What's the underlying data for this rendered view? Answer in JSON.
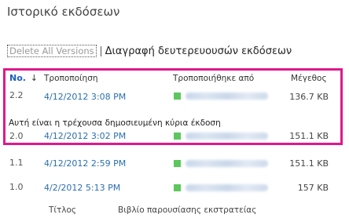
{
  "page": {
    "title": "Ιστορικό εκδόσεων"
  },
  "toolbar": {
    "delete_all_label": "Delete All Versions",
    "delete_minor_label": "Διαγραφή δευτερευουσών εκδόσεων"
  },
  "table": {
    "headers": {
      "no": "No.",
      "sort_arrow": "↓",
      "modified": "Τροποποίηση",
      "modified_by": "Τροποποιήθηκε από",
      "size": "Μέγεθος"
    },
    "current_note": "Αυτή είναι η τρέχουσα δημοσιευμένη κύρια έκδοση",
    "rows": [
      {
        "version": "2.2",
        "modified": "4/12/2012 3:08 PM",
        "size": "136.7 KB"
      },
      {
        "version": "2.0",
        "modified": "4/12/2012 3:02 PM",
        "size": "151.1 KB"
      },
      {
        "version": "1.1",
        "modified": "4/12/2012 2:59 PM",
        "size": "151.1 KB"
      },
      {
        "version": "1.0",
        "modified": "4/2/2012 5:13 PM",
        "size": "157 KB"
      }
    ]
  },
  "footer": {
    "title_label": "Τίτλος",
    "viewer_label": "Βιβλίο παρουσίασης εκστρατείας"
  },
  "colors": {
    "highlight": "#e0188c",
    "link": "#2a6fb0",
    "presence": "#5cc75c"
  }
}
